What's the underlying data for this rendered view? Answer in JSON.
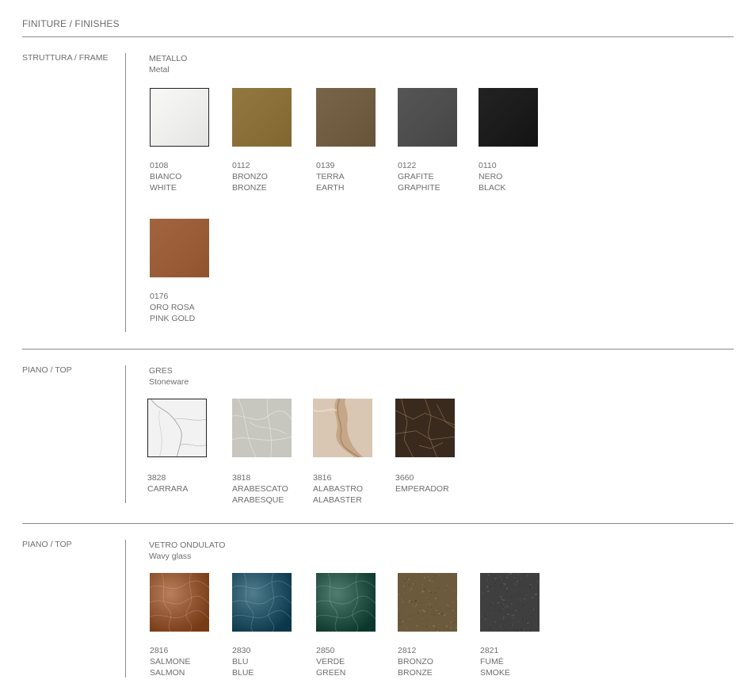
{
  "page_title": "FINITURE / FINISHES",
  "sections": [
    {
      "label": "STRUTTURA / FRAME",
      "material": "METALLO",
      "material_en": "Metal",
      "items": [
        {
          "code": "0108",
          "name_it": "BIANCO",
          "name_en": "WHITE",
          "color": "#f7f7f5",
          "bordered": true
        },
        {
          "code": "0112",
          "name_it": "BRONZO",
          "name_en": "BRONZE",
          "color": "#8b6f33"
        },
        {
          "code": "0139",
          "name_it": "TERRA",
          "name_en": "EARTH",
          "color": "#6f5a3d"
        },
        {
          "code": "0122",
          "name_it": "GRAFITE",
          "name_en": "GRAPHITE",
          "color": "#4a4a4a"
        },
        {
          "code": "0110",
          "name_it": "NERO",
          "name_en": "BLACK",
          "color": "#141414"
        },
        {
          "code": "0176",
          "name_it": "ORO ROSA",
          "name_en": "PINK GOLD",
          "color": "#9c5a32"
        }
      ]
    },
    {
      "label": "PIANO / TOP",
      "material": "GRES",
      "material_en": "Stoneware",
      "items": [
        {
          "code": "3828",
          "name_it": "CARRARA",
          "name_en": "",
          "color": "#f2f2f2",
          "bordered": true
        },
        {
          "code": "3818",
          "name_it": "ARABESCATO",
          "name_en": "ARABESQUE",
          "color": "#c7c6bf"
        },
        {
          "code": "3816",
          "name_it": "ALABASTRO",
          "name_en": "ALABASTER",
          "color": "#d9c7b4"
        },
        {
          "code": "3660",
          "name_it": "EMPERADOR",
          "name_en": "",
          "color": "#3a2a1e"
        }
      ]
    },
    {
      "label": "PIANO / TOP",
      "material": "VETRO ONDULATO",
      "material_en": "Wavy glass",
      "items": [
        {
          "code": "2816",
          "name_it": "SALMONE",
          "name_en": "SALMON",
          "color": "#9e4d1c"
        },
        {
          "code": "2830",
          "name_it": "BLU",
          "name_en": "BLUE",
          "color": "#0d4a63"
        },
        {
          "code": "2850",
          "name_it": "VERDE",
          "name_en": "GREEN",
          "color": "#0f4a3a"
        },
        {
          "code": "2812",
          "name_it": "BRONZO",
          "name_en": "BRONZE",
          "color": "#6b5a3c"
        },
        {
          "code": "2821",
          "name_it": "FUMÉ",
          "name_en": "SMOKE",
          "color": "#3f3f3f"
        }
      ]
    }
  ]
}
